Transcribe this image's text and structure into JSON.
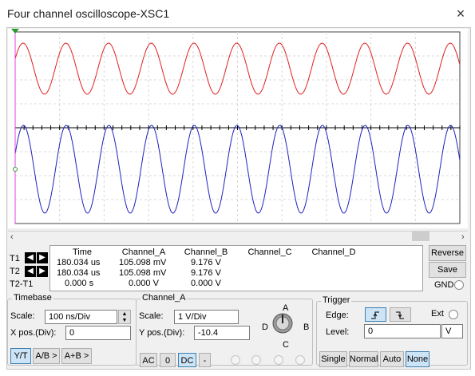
{
  "window": {
    "title": "Four channel oscilloscope-XSC1",
    "close_icon": "×"
  },
  "colors": {
    "channel_a": "#e02020",
    "channel_b": "#2020c0",
    "cursor": "#e040e0",
    "grid": "#d8d8d8"
  },
  "scroll": {
    "left": "‹",
    "right": "›"
  },
  "readout": {
    "headers": [
      "Time",
      "Channel_A",
      "Channel_B",
      "Channel_C",
      "Channel_D"
    ],
    "rows": [
      {
        "label": "T1",
        "time": "180.034 us",
        "a": "105.098 mV",
        "b": "9.176 V",
        "c": "",
        "d": ""
      },
      {
        "label": "T2",
        "time": "180.034 us",
        "a": "105.098 mV",
        "b": "9.176 V",
        "c": "",
        "d": ""
      },
      {
        "label": "T2-T1",
        "time": "0.000 s",
        "a": "0.000 V",
        "b": "0.000 V",
        "c": "",
        "d": ""
      }
    ]
  },
  "buttons": {
    "reverse": "Reverse",
    "save": "Save",
    "gnd": "GND"
  },
  "timebase": {
    "title": "Timebase",
    "scale_label": "Scale:",
    "scale_value": "100 ns/Div",
    "xpos_label": "X pos.(Div):",
    "xpos_value": "0",
    "yt": "Y/T",
    "ab": "A/B >",
    "apb": "A+B >"
  },
  "channel": {
    "title": "Channel_A",
    "scale_label": "Scale:",
    "scale_value": "1  V/Div",
    "ypos_label": "Y pos.(Div):",
    "ypos_value": "-10.4",
    "ac": "AC",
    "zero": "0",
    "dc": "DC",
    "minus": "-",
    "knob": {
      "a": "A",
      "b": "B",
      "c": "C",
      "d": "D"
    }
  },
  "trigger": {
    "title": "Trigger",
    "edge_label": "Edge:",
    "ext_label": "Ext",
    "level_label": "Level:",
    "level_value": "0",
    "level_unit": "V",
    "single": "Single",
    "normal": "Normal",
    "auto": "Auto",
    "none": "None",
    "rising_icon": "rising-edge",
    "falling_icon": "falling-edge"
  }
}
